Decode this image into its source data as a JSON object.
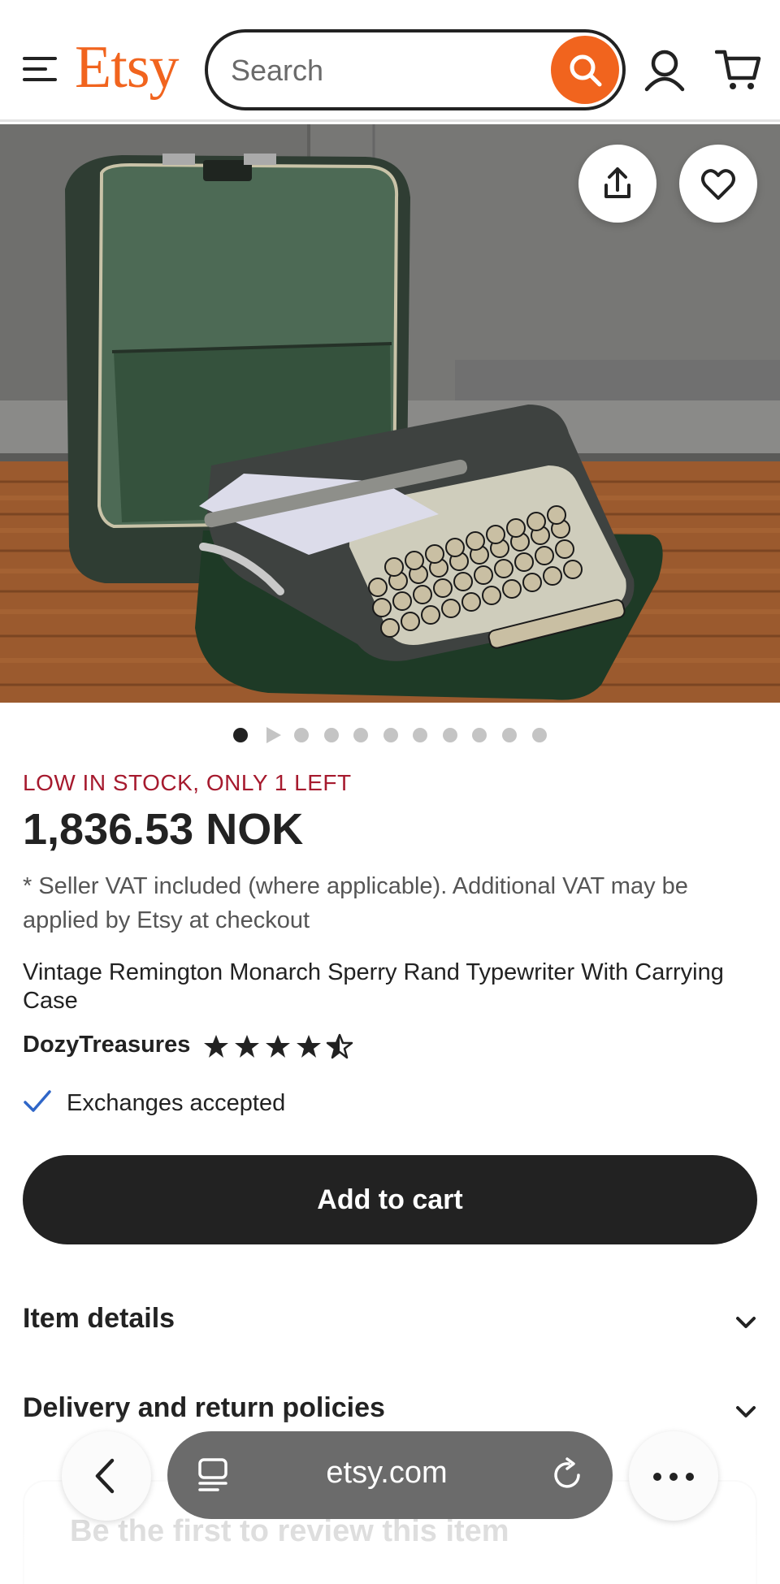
{
  "header": {
    "logo": "Etsy",
    "search": {
      "placeholder": "Search",
      "value": ""
    },
    "icons": [
      "menu-icon",
      "search-icon",
      "user-icon",
      "cart-icon"
    ]
  },
  "hero": {
    "image_alt": "Vintage Remington Monarch typewriter in open green carrying case",
    "actions": [
      "share-icon",
      "heart-icon"
    ],
    "gallery_count": 11,
    "active_index": 0
  },
  "product": {
    "stock_notice": "LOW IN STOCK, ONLY 1 LEFT",
    "price": "1,836.53 NOK",
    "vat_note": "* Seller VAT included (where applicable). Additional VAT may be applied by Etsy at checkout",
    "title": "Vintage Remington Monarch Sperry Rand Typewriter With Carrying Case",
    "shop_name": "DozyTreasures",
    "rating": 4.5,
    "exchange": "Exchanges accepted",
    "add_to_cart": "Add to cart"
  },
  "sections": {
    "item_details": "Item details",
    "delivery": "Delivery and return policies",
    "review_prompt": "Be the first to review this item"
  },
  "browser": {
    "url": "etsy.com"
  },
  "colors": {
    "brand": "#f1641e",
    "stock": "#a61a2e",
    "check": "#2f66c8",
    "primary_button": "#222222"
  }
}
